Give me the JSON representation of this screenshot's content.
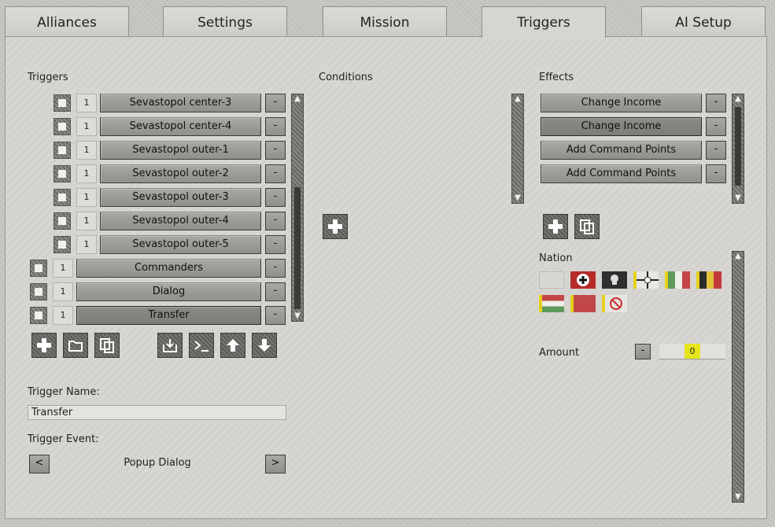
{
  "tabs": [
    "Alliances",
    "Settings",
    "Mission",
    "Triggers",
    "AI Setup"
  ],
  "active_tab": "Triggers",
  "triggers": {
    "label": "Triggers",
    "items": [
      {
        "name": "Sevastopol center-3",
        "count": "1"
      },
      {
        "name": "Sevastopol center-4",
        "count": "1"
      },
      {
        "name": "Sevastopol outer-1",
        "count": "1"
      },
      {
        "name": "Sevastopol outer-2",
        "count": "1"
      },
      {
        "name": "Sevastopol outer-3",
        "count": "1"
      },
      {
        "name": "Sevastopol outer-4",
        "count": "1"
      },
      {
        "name": "Sevastopol outer-5",
        "count": "1"
      },
      {
        "name": "Commanders",
        "count": "1"
      },
      {
        "name": "Dialog",
        "count": "1"
      },
      {
        "name": "Transfer",
        "count": "1"
      }
    ],
    "remove_label": "-",
    "selected": "Transfer",
    "toolbar_icons": [
      "add-icon",
      "folder-icon",
      "copy-icon",
      "import-icon",
      "console-icon",
      "move-up-icon",
      "move-down-icon"
    ]
  },
  "conditions": {
    "label": "Conditions",
    "add_icon": "add-icon"
  },
  "effects": {
    "label": "Effects",
    "items": [
      "Change Income",
      "Change Income",
      "Add Command Points",
      "Add Command Points"
    ],
    "remove_label": "-",
    "selected_index": 1,
    "toolbar_icons": [
      "add-icon",
      "copy-icon"
    ]
  },
  "nation": {
    "label": "Nation",
    "flags": [
      "neutral-flag",
      "germany-flag",
      "ss-flag",
      "kriegsmarine-flag",
      "italy-flag",
      "belgium-flag",
      "hungary-flag",
      "red-flag",
      "none-flag"
    ]
  },
  "amount": {
    "label": "Amount",
    "minus": "-",
    "value": "0"
  },
  "trigger_name": {
    "label": "Trigger Name:",
    "value": "Transfer"
  },
  "trigger_event": {
    "label": "Trigger Event:",
    "value": "Popup Dialog",
    "prev": "<",
    "next": ">"
  },
  "colors": {
    "accent_yellow": "#e6e61c",
    "button_bg": "#9e9d99",
    "panel_bg": "#d6d5d1"
  }
}
